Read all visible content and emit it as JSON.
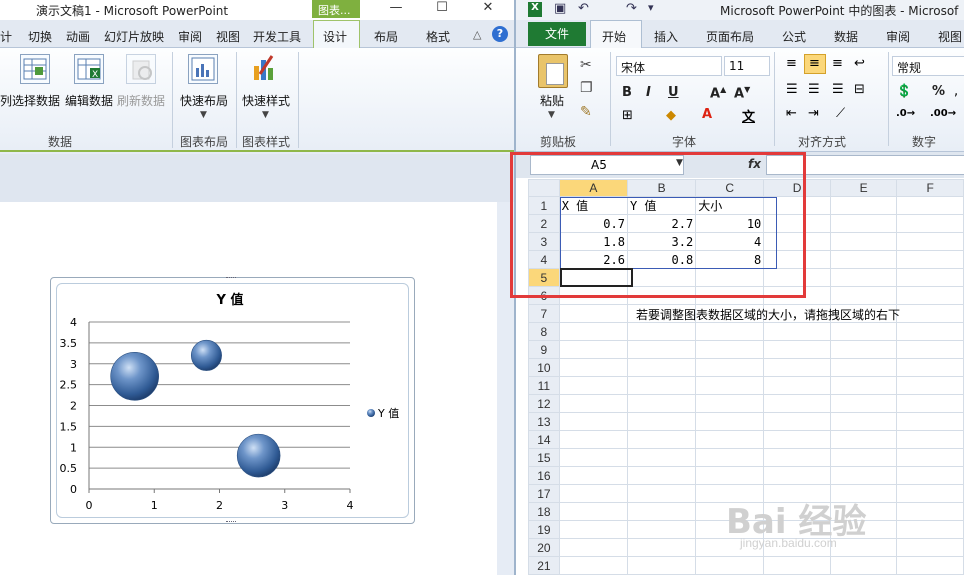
{
  "powerpoint": {
    "title": "演示文稿1 - Microsoft PowerPoint",
    "context_tab": "图表...",
    "window_controls": [
      "—",
      "☐",
      "✕"
    ],
    "tabs": [
      "计",
      "切换",
      "动画",
      "幻灯片放映",
      "审阅",
      "视图",
      "开发工具",
      "设计",
      "布局",
      "格式"
    ],
    "active_tab": "设计",
    "ribbon": {
      "buttons": [
        "列",
        "选择数据",
        "编辑数据",
        "刷新数据",
        "快速布局",
        "快速样式"
      ],
      "groups": [
        "数据",
        "图表布局",
        "图表样式"
      ]
    },
    "chart": {
      "title": "Y 值",
      "legend": "Y 值"
    }
  },
  "chart_data": {
    "type": "bubble",
    "title": "Y 值",
    "series": [
      {
        "name": "Y 值",
        "x": [
          0.7,
          1.8,
          2.6
        ],
        "y": [
          2.7,
          3.2,
          0.8
        ],
        "size": [
          10,
          4,
          8
        ]
      }
    ],
    "xlim": [
      0,
      4
    ],
    "ylim": [
      0,
      4
    ],
    "x_ticks": [
      "0",
      "1",
      "2",
      "3",
      "4"
    ],
    "y_ticks": [
      "0",
      "0.5",
      "1",
      "1.5",
      "2",
      "2.5",
      "3",
      "3.5",
      "4"
    ],
    "grid": "horizontal",
    "legend_position": "right"
  },
  "excel": {
    "title": "Microsoft PowerPoint 中的图表 - Microsof",
    "tabs": [
      "文件",
      "开始",
      "插入",
      "页面布局",
      "公式",
      "数据",
      "审阅",
      "视图"
    ],
    "active_tab": "开始",
    "ribbon": {
      "paste_label": "粘贴",
      "font_name": "宋体",
      "font_size": "11",
      "number_format": "常规",
      "groups": [
        "剪贴板",
        "字体",
        "对齐方式",
        "数字"
      ],
      "pinyin_label": "文"
    },
    "name_box": "A5",
    "fx_label": "fx",
    "column_headers": [
      "A",
      "B",
      "C",
      "D",
      "E",
      "F"
    ],
    "rows": [
      [
        "X 值",
        "Y 值",
        "大小"
      ],
      [
        "0.7",
        "2.7",
        "10"
      ],
      [
        "1.8",
        "3.2",
        "4"
      ],
      [
        "2.6",
        "0.8",
        "8"
      ],
      [
        "",
        "",
        ""
      ],
      [
        "",
        "",
        ""
      ],
      [
        "",
        "",
        ""
      ]
    ],
    "note": "若要调整图表数据区域的大小，请拖拽区域的右下",
    "row_count": 21
  },
  "watermark": {
    "text": "Bai 经验",
    "sub": "jingyan.baidu.com"
  }
}
